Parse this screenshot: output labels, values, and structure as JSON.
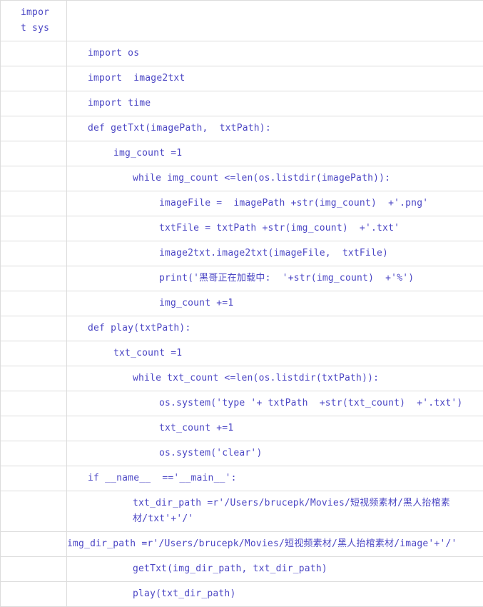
{
  "document": {
    "type": "code-listing-table",
    "language": "python",
    "text_color": "#4b46c4",
    "border_color": "#dcdcdc",
    "background_color": "#ffffff"
  },
  "table": {
    "columns": 2,
    "left_column": {
      "cells": [
        {
          "line1": "impor",
          "line2": "t sys"
        }
      ]
    },
    "rows": [
      {
        "indent": 0,
        "text": "import sys",
        "wrapped": true
      },
      {
        "indent": 0,
        "text": "import os"
      },
      {
        "indent": 0,
        "text": "import  image2txt"
      },
      {
        "indent": 0,
        "text": "import time"
      },
      {
        "indent": 0,
        "text": "def getTxt(imagePath,  txtPath):"
      },
      {
        "indent": 1,
        "text": "img_count =1"
      },
      {
        "indent": 2,
        "text": "while img_count <=len(os.listdir(imagePath)):"
      },
      {
        "indent": 3,
        "text": "imageFile =  imagePath +str(img_count)  +'.png'"
      },
      {
        "indent": 3,
        "text": "txtFile = txtPath +str(img_count)  +'.txt'"
      },
      {
        "indent": 3,
        "text": "image2txt.image2txt(imageFile,  txtFile)"
      },
      {
        "indent": 3,
        "text": "print('黑哥正在加载中:  '+str(img_count)  +'%')"
      },
      {
        "indent": 3,
        "text": "img_count +=1"
      },
      {
        "indent": 0,
        "text": "def play(txtPath):"
      },
      {
        "indent": 1,
        "text": "txt_count =1"
      },
      {
        "indent": 2,
        "text": "while txt_count <=len(os.listdir(txtPath)):"
      },
      {
        "indent": 3,
        "text": "os.system('type '+ txtPath  +str(txt_count)  +'.txt')"
      },
      {
        "indent": 3,
        "text": "txt_count +=1"
      },
      {
        "indent": 3,
        "text": "os.system('clear')"
      },
      {
        "indent": 0,
        "text": "if __name__  =='__main__':"
      },
      {
        "indent": 2,
        "text": "txt_dir_path =r'/Users/brucepk/Movies/短视频素材/黑人抬棺素材/txt'+'/'"
      },
      {
        "indent": 2,
        "text": "img_dir_path =r'/Users/brucepk/Movies/短视频素材/黑人抬棺素材/image'+'/'",
        "wraps": true
      },
      {
        "indent": 2,
        "text": "getTxt(img_dir_path, txt_dir_path)"
      },
      {
        "indent": 2,
        "text": "play(txt_dir_path)"
      }
    ]
  }
}
